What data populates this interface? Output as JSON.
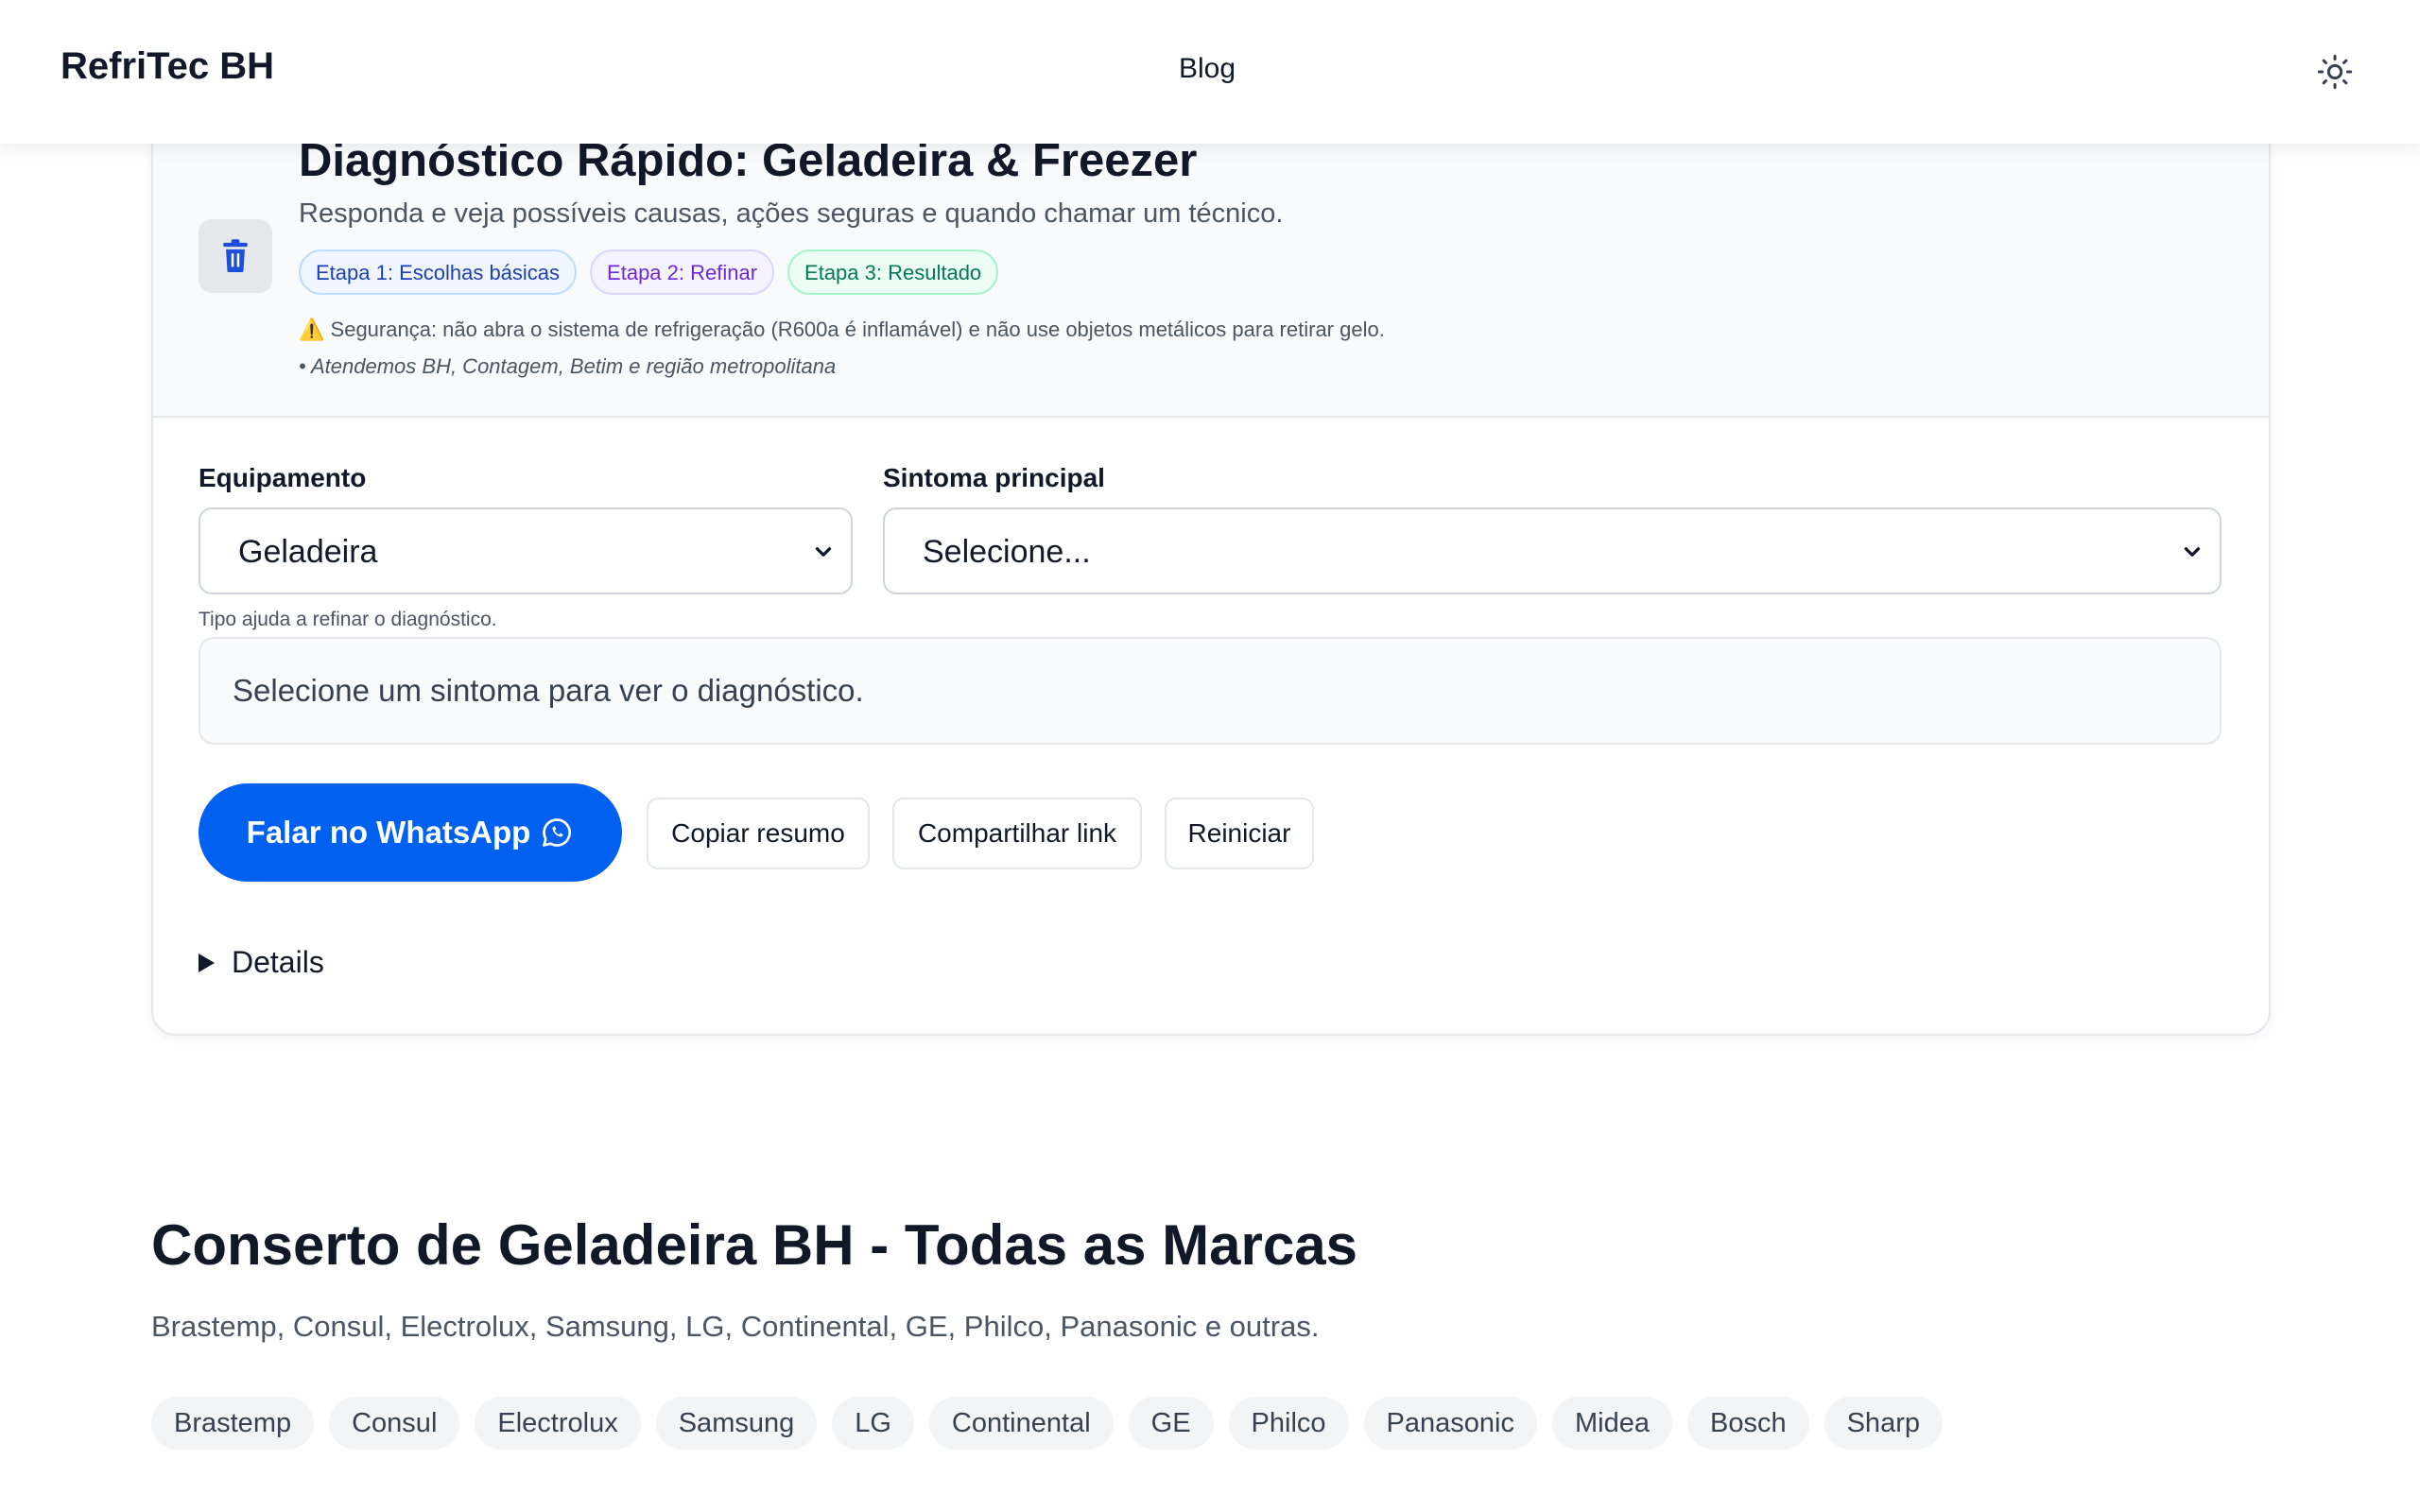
{
  "header": {
    "brand": "RefriTec BH",
    "nav_blog": "Blog",
    "theme_icon": "sun-icon"
  },
  "diagnostic": {
    "icon": "trash-icon",
    "title": "Diagnóstico Rápido: Geladeira & Freezer",
    "subtitle": "Responda e veja possíveis causas, ações seguras e quando chamar um técnico.",
    "steps": [
      "Etapa 1: Escolhas básicas",
      "Etapa 2: Refinar",
      "Etapa 3: Resultado"
    ],
    "safety_emoji": "⚠️",
    "safety": "Segurança: não abra o sistema de refrigeração (R600a é inflamável) e não use objetos metálicos para retirar gelo.",
    "areas": "• Atendemos BH, Contagem, Betim e região metropolitana",
    "equipment_label": "Equipamento",
    "equipment_value": "Geladeira",
    "symptom_label": "Sintoma principal",
    "symptom_value": "Selecione...",
    "hint": "Tipo ajuda a refinar o diagnóstico.",
    "result_placeholder": "Selecione um sintoma para ver o diagnóstico.",
    "whatsapp_label": "Falar no WhatsApp",
    "copy_label": "Copiar resumo",
    "share_label": "Compartilhar link",
    "reset_label": "Reiniciar",
    "details_label": "Details"
  },
  "brands_section": {
    "title": "Conserto de Geladeira BH - Todas as Marcas",
    "subtitle": "Brastemp, Consul, Electrolux, Samsung, LG, Continental, GE, Philco, Panasonic e outras.",
    "brands": [
      "Brastemp",
      "Consul",
      "Electrolux",
      "Samsung",
      "LG",
      "Continental",
      "GE",
      "Philco",
      "Panasonic",
      "Midea",
      "Bosch",
      "Sharp"
    ]
  },
  "colors": {
    "primary": "#0060f0",
    "step1": "#1e40af",
    "step2": "#6d28d9",
    "step3": "#047857"
  }
}
